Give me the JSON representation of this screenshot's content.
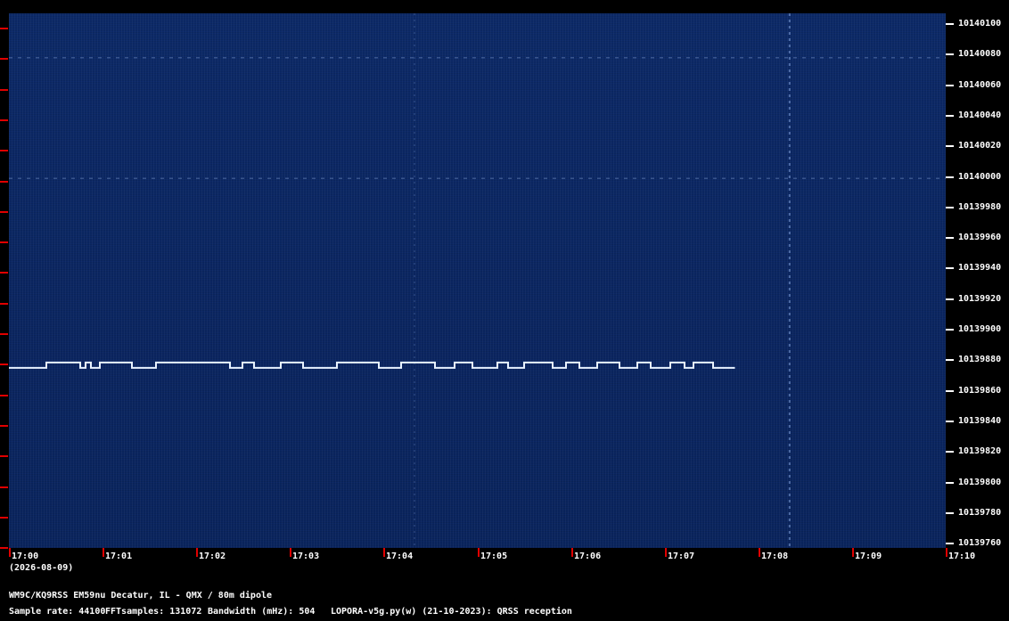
{
  "plot": {
    "background_color": "#0b2764",
    "signal_color": "#e8f2ff",
    "tick_color": "#e00000",
    "signal_frequency_hz": 10139875,
    "signal_end_time": "17:07:45",
    "carrier_frequencies_hz": [
      10140078,
      10139999
    ],
    "vertical_streak_time": "17:08:20"
  },
  "y_axis": {
    "labels": [
      "10140100",
      "10140080",
      "10140060",
      "10140040",
      "10140020",
      "10140000",
      "10139980",
      "10139960",
      "10139940",
      "10139920",
      "10139900",
      "10139880",
      "10139860",
      "10139840",
      "10139820",
      "10139800",
      "10139780",
      "10139760"
    ]
  },
  "x_axis": {
    "labels": [
      "17:00",
      "17:01",
      "17:02",
      "17:03",
      "17:04",
      "17:05",
      "17:06",
      "17:07",
      "17:08",
      "17:09",
      "17:10"
    ],
    "date": "(2026-08-09)"
  },
  "footer": {
    "station": "WM9C/KQ9RSS EM59nu Decatur, IL - QMX / 80m dipole",
    "sample_rate": "Sample rate: 44100",
    "fft_samples": "FFTsamples: 131072",
    "bandwidth": "Bandwidth (mHz): 504",
    "software": "LOPORA-v5g.py(w) (21-10-2023): QRSS reception"
  }
}
